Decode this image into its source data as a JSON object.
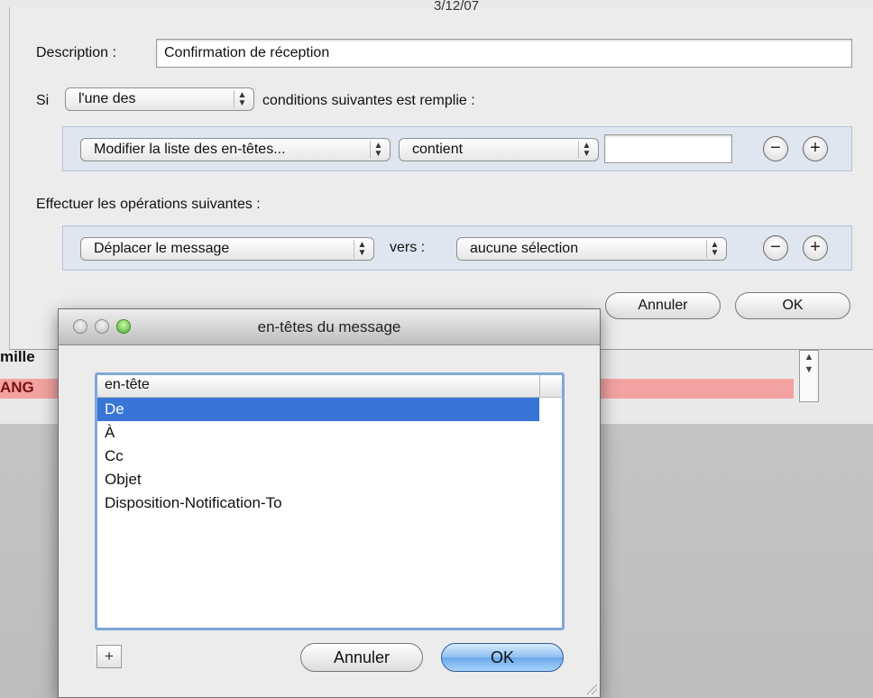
{
  "top_title": "3/12/07",
  "rule_sheet": {
    "description_label": "Description :",
    "description_value": "Confirmation de réception",
    "si_label": "Si",
    "condition_mode": "l'une des",
    "condition_suffix": "conditions suivantes est remplie :",
    "condition": {
      "field": "Modifier la liste des en-têtes...",
      "operator": "contient",
      "value": ""
    },
    "actions_label": "Effectuer les opérations suivantes :",
    "action": {
      "operation": "Déplacer le message",
      "vers_label": "vers :",
      "target": "aucune sélection"
    },
    "remove_symbol": "−",
    "add_symbol": "+",
    "cancel_label": "Annuler",
    "ok_label": "OK"
  },
  "background": {
    "row1_text": "mille",
    "row2_text": "ANG",
    "stripe_color": "#f3a2a2"
  },
  "headers_dialog": {
    "title": "en-têtes du message",
    "column_header": "en-tête",
    "rows": [
      "De",
      "À",
      "Cc",
      "Objet",
      "Disposition-Notification-To"
    ],
    "selected_index": 0,
    "add_symbol": "+",
    "cancel_label": "Annuler",
    "ok_label": "OK"
  },
  "colors": {
    "selection": "#3875d7",
    "focus_ring": "#7ea8d8",
    "default_button": "#6aa8ea"
  }
}
